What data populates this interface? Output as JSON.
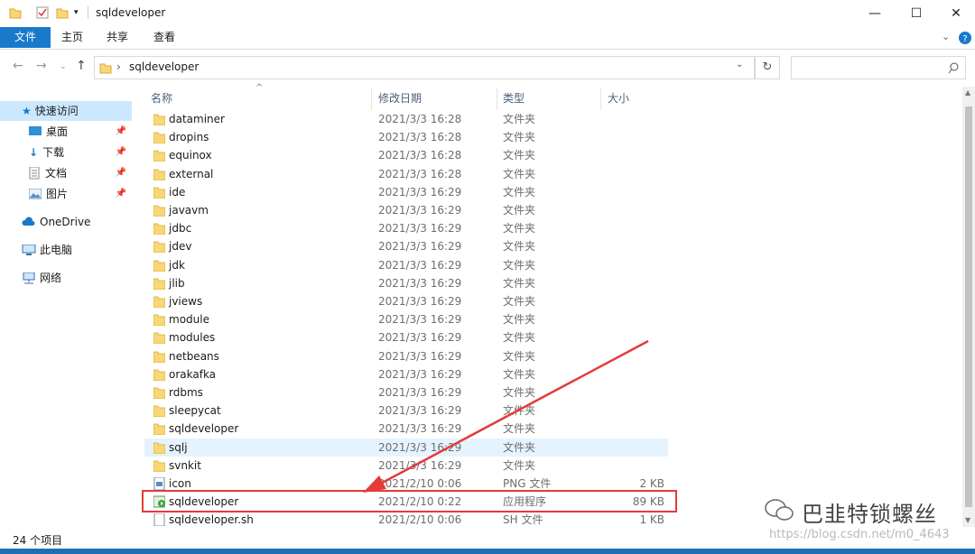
{
  "window": {
    "title": "sqldeveloper",
    "controls": {
      "minimize": "—",
      "maximize": "☐",
      "close": "✕"
    }
  },
  "ribbon": {
    "tabs": [
      "文件",
      "主页",
      "共享",
      "查看"
    ]
  },
  "address": {
    "path": "sqldeveloper",
    "separator": "›"
  },
  "nav_pane": {
    "items": [
      {
        "label": "快速访问",
        "icon": "star-icon",
        "selected": true
      },
      {
        "label": "桌面",
        "icon": "desktop-icon",
        "pinned": true
      },
      {
        "label": "下载",
        "icon": "download-icon",
        "pinned": true
      },
      {
        "label": "文档",
        "icon": "document-icon",
        "pinned": true
      },
      {
        "label": "图片",
        "icon": "picture-icon",
        "pinned": true
      },
      {
        "label": "OneDrive",
        "icon": "cloud-icon"
      },
      {
        "label": "此电脑",
        "icon": "computer-icon"
      },
      {
        "label": "网络",
        "icon": "network-icon"
      }
    ]
  },
  "columns": {
    "name": "名称",
    "date": "修改日期",
    "type": "类型",
    "size": "大小"
  },
  "files": [
    {
      "name": "dataminer",
      "date": "2021/3/3 16:28",
      "type": "文件夹",
      "size": "",
      "icon": "folder-icon"
    },
    {
      "name": "dropins",
      "date": "2021/3/3 16:28",
      "type": "文件夹",
      "size": "",
      "icon": "folder-icon"
    },
    {
      "name": "equinox",
      "date": "2021/3/3 16:28",
      "type": "文件夹",
      "size": "",
      "icon": "folder-icon"
    },
    {
      "name": "external",
      "date": "2021/3/3 16:28",
      "type": "文件夹",
      "size": "",
      "icon": "folder-icon"
    },
    {
      "name": "ide",
      "date": "2021/3/3 16:29",
      "type": "文件夹",
      "size": "",
      "icon": "folder-icon"
    },
    {
      "name": "javavm",
      "date": "2021/3/3 16:29",
      "type": "文件夹",
      "size": "",
      "icon": "folder-icon"
    },
    {
      "name": "jdbc",
      "date": "2021/3/3 16:29",
      "type": "文件夹",
      "size": "",
      "icon": "folder-icon"
    },
    {
      "name": "jdev",
      "date": "2021/3/3 16:29",
      "type": "文件夹",
      "size": "",
      "icon": "folder-icon"
    },
    {
      "name": "jdk",
      "date": "2021/3/3 16:29",
      "type": "文件夹",
      "size": "",
      "icon": "folder-icon"
    },
    {
      "name": "jlib",
      "date": "2021/3/3 16:29",
      "type": "文件夹",
      "size": "",
      "icon": "folder-icon"
    },
    {
      "name": "jviews",
      "date": "2021/3/3 16:29",
      "type": "文件夹",
      "size": "",
      "icon": "folder-icon"
    },
    {
      "name": "module",
      "date": "2021/3/3 16:29",
      "type": "文件夹",
      "size": "",
      "icon": "folder-icon"
    },
    {
      "name": "modules",
      "date": "2021/3/3 16:29",
      "type": "文件夹",
      "size": "",
      "icon": "folder-icon"
    },
    {
      "name": "netbeans",
      "date": "2021/3/3 16:29",
      "type": "文件夹",
      "size": "",
      "icon": "folder-icon"
    },
    {
      "name": "orakafka",
      "date": "2021/3/3 16:29",
      "type": "文件夹",
      "size": "",
      "icon": "folder-icon"
    },
    {
      "name": "rdbms",
      "date": "2021/3/3 16:29",
      "type": "文件夹",
      "size": "",
      "icon": "folder-icon"
    },
    {
      "name": "sleepycat",
      "date": "2021/3/3 16:29",
      "type": "文件夹",
      "size": "",
      "icon": "folder-icon"
    },
    {
      "name": "sqldeveloper",
      "date": "2021/3/3 16:29",
      "type": "文件夹",
      "size": "",
      "icon": "folder-icon"
    },
    {
      "name": "sqlj",
      "date": "2021/3/3 16:29",
      "type": "文件夹",
      "size": "",
      "icon": "folder-icon",
      "hover": true
    },
    {
      "name": "svnkit",
      "date": "2021/3/3 16:29",
      "type": "文件夹",
      "size": "",
      "icon": "folder-icon"
    },
    {
      "name": "icon",
      "date": "2021/2/10 0:06",
      "type": "PNG 文件",
      "size": "2 KB",
      "icon": "image-file-icon"
    },
    {
      "name": "sqldeveloper",
      "date": "2021/2/10 0:22",
      "type": "应用程序",
      "size": "89 KB",
      "icon": "application-icon",
      "highlighted": true
    },
    {
      "name": "sqldeveloper.sh",
      "date": "2021/2/10 0:06",
      "type": "SH 文件",
      "size": "1 KB",
      "icon": "text-file-icon"
    }
  ],
  "status": {
    "item_count": "24 个项目"
  },
  "watermark": {
    "text": "巴韭特锁螺丝",
    "url": "https://blog.csdn.net/m0_4643"
  },
  "colors": {
    "accent": "#1979ca",
    "highlight_box": "#e53a3a",
    "arrow": "#e53a3a",
    "selection": "#cce8ff"
  }
}
